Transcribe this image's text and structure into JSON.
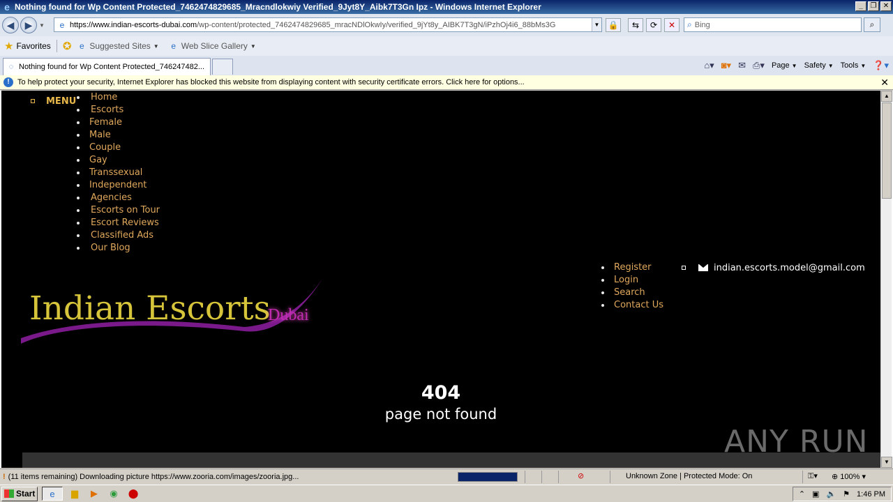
{
  "window": {
    "title": "Nothing found for Wp Content Protected_7462474829685_Mracndlokwiy Verified_9Jyt8Y_Aibk7T3Gn Ipz - Windows Internet Explorer",
    "minimize": "_",
    "restore": "❐",
    "close": "✕"
  },
  "address": {
    "url_host": "https://www.indian-escorts-dubai.com",
    "url_path": "/wp-content/protected_7462474829685_mracNDlOkwIy/verified_9jYt8y_AIBK7T3gN/iPzhOj4i6_88bMs3G",
    "search_placeholder": "Bing"
  },
  "favorites": {
    "label": "Favorites",
    "items": [
      "Suggested Sites",
      "Web Slice Gallery"
    ]
  },
  "tabs": {
    "active_label": "Nothing found for Wp Content Protected_746247482...",
    "commands": [
      "Page",
      "Safety",
      "Tools"
    ]
  },
  "infobar": {
    "text": "To help protect your security, Internet Explorer has blocked this website from displaying content with security certificate errors. Click here for options..."
  },
  "page": {
    "menu_label": "MENU",
    "nav": [
      "Home",
      "Escorts",
      "Female",
      "Male",
      "Couple",
      "Gay",
      "Transsexual",
      "Independent",
      "Agencies",
      "Escorts on Tour",
      "Escort Reviews",
      "Classified Ads",
      "Our Blog"
    ],
    "account_links": [
      "Register",
      "Login",
      "Search",
      "Contact Us"
    ],
    "email": "indian.escorts.model@gmail.com",
    "logo_main": "Indian Escorts",
    "logo_sub": "Dubai",
    "error_code": "404",
    "error_message": "page not found",
    "watermark": "ANY RUN"
  },
  "status": {
    "text": "(11 items remaining) Downloading picture https://www.zooria.com/images/zooria.jpg...",
    "progress": 1.0,
    "zone": "Unknown Zone | Protected Mode: On",
    "zoom": "100%"
  },
  "taskbar": {
    "start": "Start",
    "clock": "1:46 PM"
  },
  "colors": {
    "link": "#e0a85c",
    "logo_gold": "#d6c43a",
    "logo_purple": "#7a1a8a",
    "page_bg": "#000000"
  }
}
